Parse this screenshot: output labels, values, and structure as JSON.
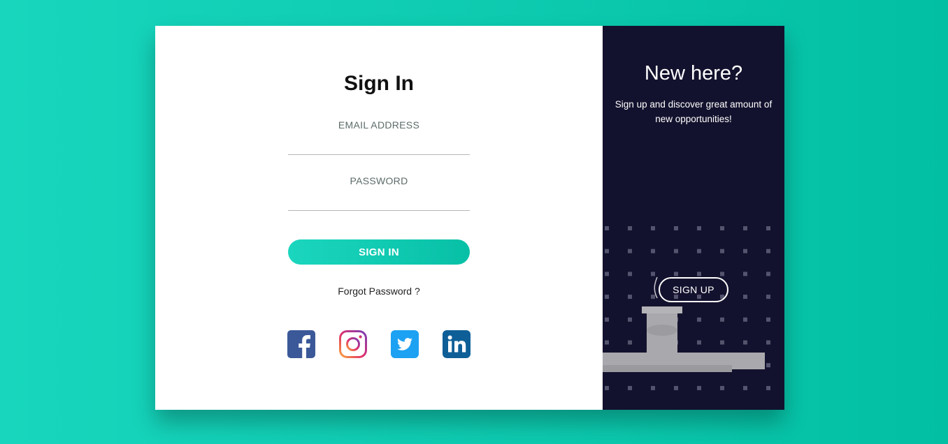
{
  "signin": {
    "title": "Sign In",
    "email_label": "EMAIL ADDRESS",
    "email_value": "",
    "password_label": "PASSWORD",
    "password_value": "",
    "button_label": "SIGN IN",
    "forgot_label": "Forgot Password ?",
    "socials": [
      {
        "name": "facebook",
        "icon": "facebook-icon",
        "color": "#3b5998"
      },
      {
        "name": "instagram",
        "icon": "instagram-icon",
        "color": "#c13584"
      },
      {
        "name": "twitter",
        "icon": "twitter-icon",
        "color": "#1da1f2"
      },
      {
        "name": "linkedin",
        "icon": "linkedin-icon",
        "color": "#0e76a8"
      }
    ]
  },
  "signup_panel": {
    "title": "New here?",
    "text": "Sign up and discover great amount of new opportunities!",
    "button_label": "SIGN UP"
  },
  "colors": {
    "accent": "#0fcbb1",
    "panel_bg": "#13122e",
    "page_bg": "#10d0b6"
  }
}
